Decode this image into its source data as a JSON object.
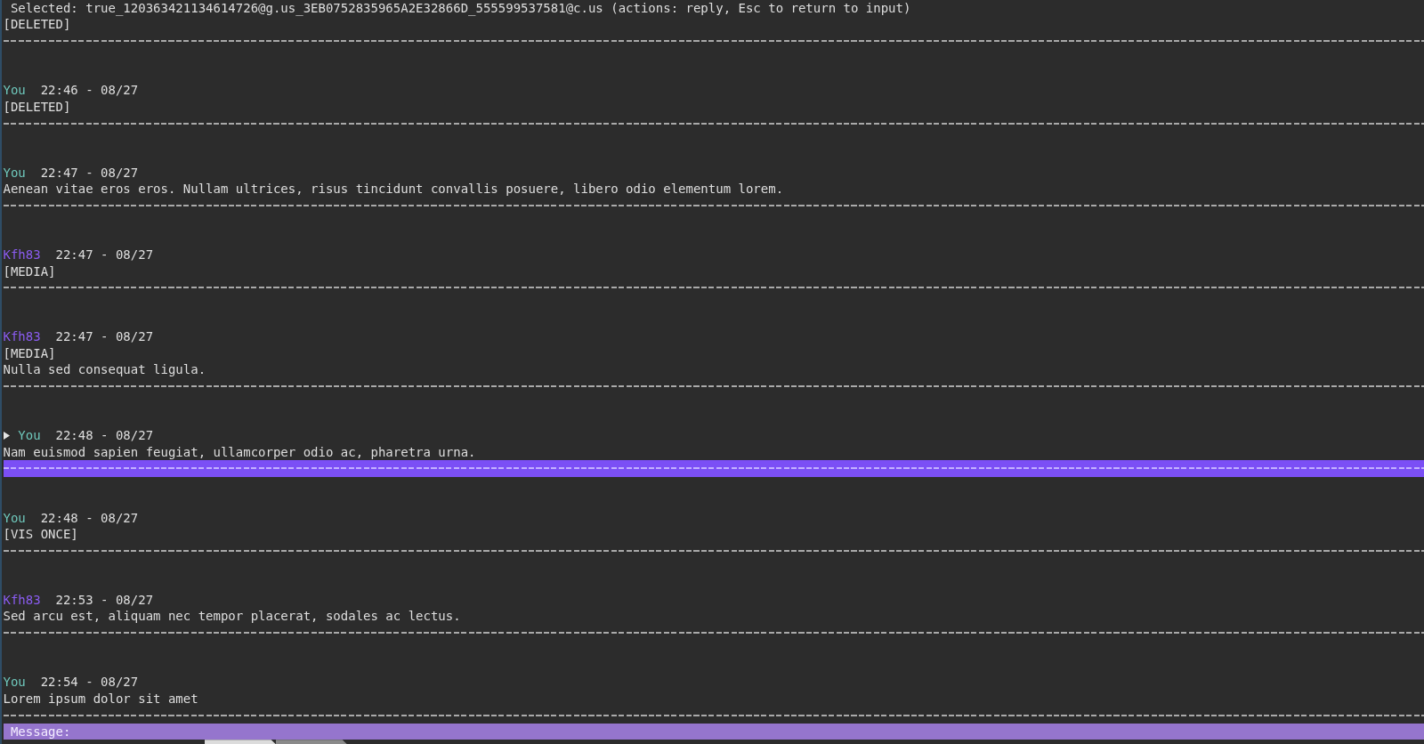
{
  "selection_bar": {
    "text": "Selected: true_120363421134614726@g.us_3EB0752835965A2E32866D_555599537581@c.us (actions: reply, Esc to return to input)"
  },
  "messages": [
    {
      "lines": [
        "[DELETED]"
      ],
      "selected": false
    },
    {
      "sender": "You",
      "color": "#6fc8bc",
      "time": "22:46 - 08/27",
      "lines": [
        "[DELETED]"
      ],
      "selected": false
    },
    {
      "sender": "You",
      "color": "#6fc8bc",
      "time": "22:47 - 08/27",
      "lines": [
        "Aenean vitae eros eros. Nullam ultrices, risus tincidunt convallis posuere, libero odio elementum lorem."
      ],
      "selected": false
    },
    {
      "sender": "Kfh83",
      "color": "#8a5cf0",
      "time": "22:47 - 08/27",
      "lines": [
        "[MEDIA]"
      ],
      "selected": false
    },
    {
      "sender": "Kfh83",
      "color": "#8a5cf0",
      "time": "22:47 - 08/27",
      "lines": [
        "[MEDIA]",
        "Nulla sed consequat ligula."
      ],
      "selected": false
    },
    {
      "sender": "You",
      "color": "#6fc8bc",
      "time": "22:48 - 08/27",
      "lines": [
        "Nam euismod sapien feugiat, ullamcorper odio ac, pharetra urna."
      ],
      "selected": true
    },
    {
      "sender": "You",
      "color": "#6fc8bc",
      "time": "22:48 - 08/27",
      "lines": [
        "[VIS ONCE]"
      ],
      "selected": false
    },
    {
      "sender": "Kfh83",
      "color": "#8a5cf0",
      "time": "22:53 - 08/27",
      "lines": [
        "Sed arcu est, aliquam nec tempor placerat, sodales ac lectus."
      ],
      "selected": false
    },
    {
      "sender": "You",
      "color": "#6fc8bc",
      "time": "22:54 - 08/27",
      "lines": [
        "Lorem ipsum dolor sit amet"
      ],
      "selected": false
    }
  ],
  "input": {
    "label": "Message:"
  },
  "status_bar": {
    "tabs": [
      {
        "selected": true
      },
      {
        "selected": false
      }
    ]
  }
}
